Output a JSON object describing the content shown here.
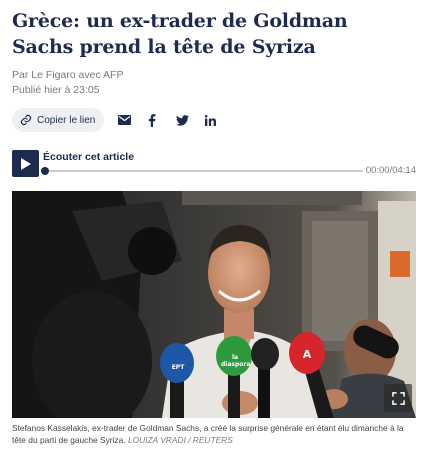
{
  "article": {
    "headline": "Grèce: un ex-trader de Goldman Sachs prend la tête de Syriza",
    "byline": "Par Le Figaro avec AFP",
    "published": "Publié hier à 23:05"
  },
  "share": {
    "copy_link_label": "Copier le lien",
    "icons": [
      "link-icon",
      "mail-icon",
      "facebook-icon",
      "twitter-icon",
      "linkedin-icon"
    ]
  },
  "audio": {
    "label": "Écouter cet article",
    "time": "00:00/04:14",
    "progress": 0
  },
  "photo": {
    "caption": "Stefanos Kasselakis, ex-trader de Goldman Sachs, a créé la surprise générale en étant élu dimanche à la tête du parti de gauche Syriza.",
    "credit": "LOUIZA VRADI / REUTERS",
    "mic_logos": [
      "la diaspora",
      "EPT",
      "A"
    ]
  },
  "colors": {
    "navy": "#1d2b4f",
    "chip_bg": "#eef0f3",
    "muted": "#7a7a7a"
  }
}
